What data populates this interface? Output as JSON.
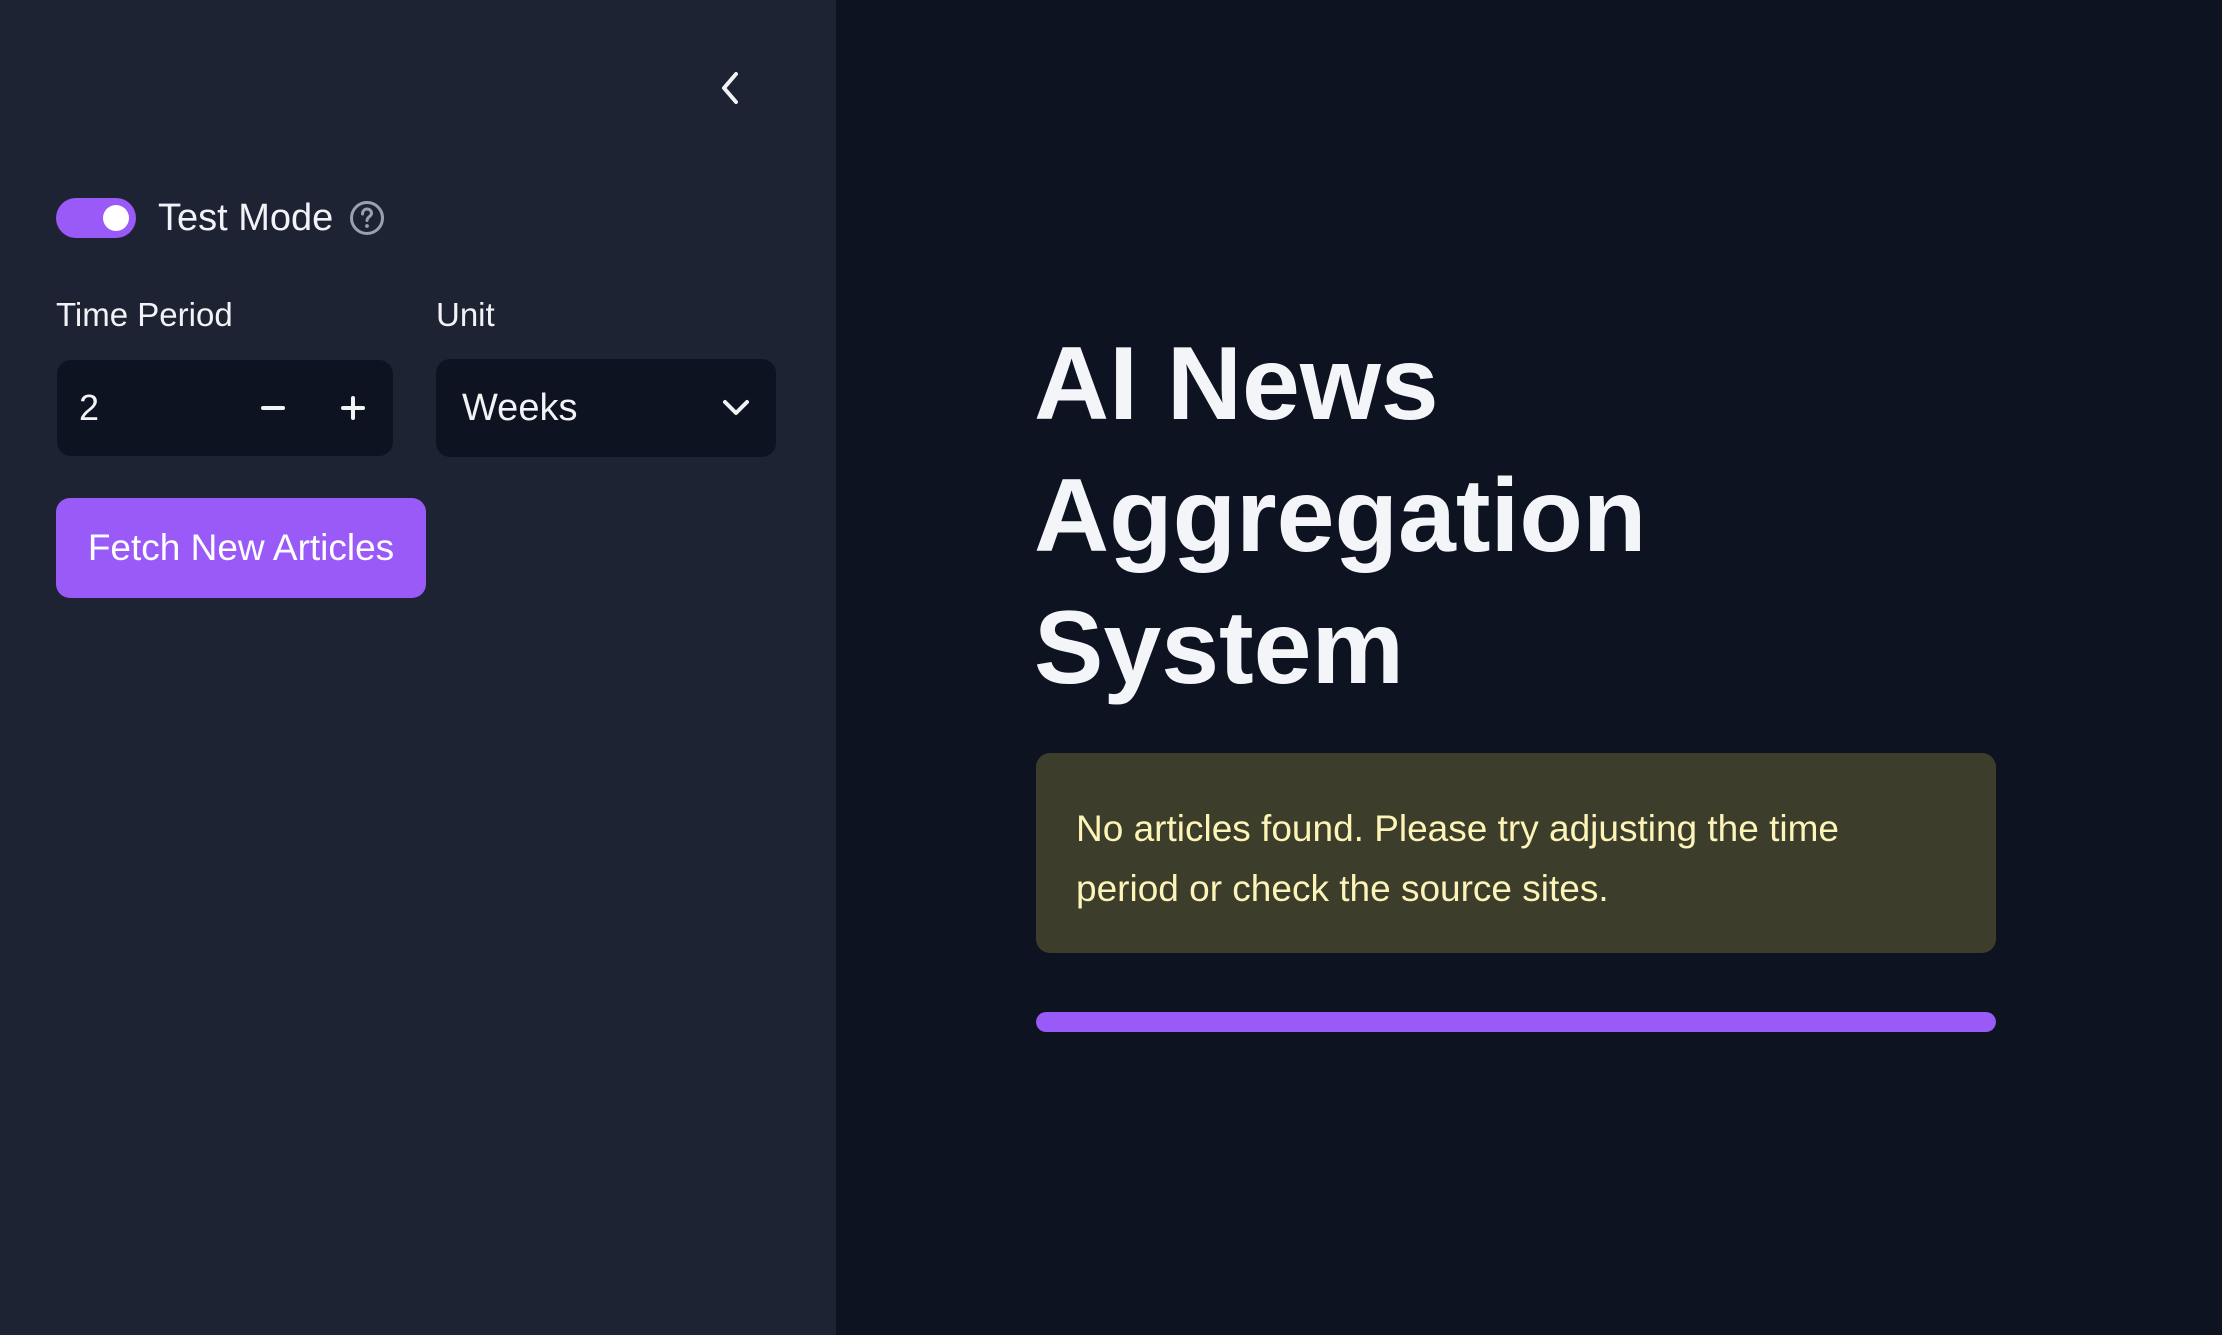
{
  "sidebar": {
    "collapse_icon": "chevron-left-icon",
    "test_mode": {
      "label": "Test Mode",
      "enabled": true,
      "help_icon": "question-circle-icon"
    },
    "time_period": {
      "label": "Time Period",
      "value": "2",
      "decrement_icon": "minus-icon",
      "increment_icon": "plus-icon"
    },
    "unit": {
      "label": "Unit",
      "selected": "Weeks",
      "dropdown_icon": "chevron-down-icon"
    },
    "fetch_button": {
      "label": "Fetch New Articles"
    }
  },
  "main": {
    "title": "AI News Aggregation System",
    "alert": {
      "message": "No articles found. Please try adjusting the time period or check the source sites."
    },
    "progress": {
      "value_percent": 100
    }
  },
  "colors": {
    "accent": "#9a5af8",
    "sidebar_bg": "#1e2333",
    "main_bg": "#0e1321",
    "input_bg": "#0e1321",
    "text": "#f2f3f7",
    "warning_bg": "#3d3d2b",
    "warning_text": "#fdf4b8",
    "muted_icon": "#9aa0ae"
  }
}
